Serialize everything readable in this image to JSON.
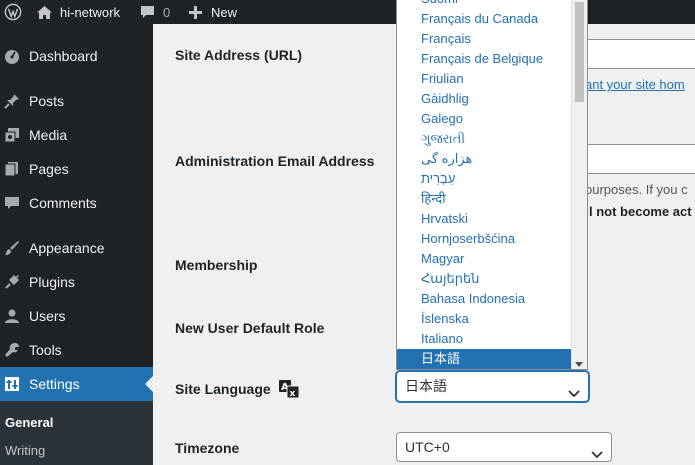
{
  "adminbar": {
    "site_name": "hi-network",
    "comments_count": "0",
    "new_label": "New"
  },
  "sidebar": {
    "items": [
      {
        "label": "Dashboard",
        "icon": "dashboard-icon"
      },
      {
        "label": "Posts",
        "icon": "pin-icon"
      },
      {
        "label": "Media",
        "icon": "media-icon"
      },
      {
        "label": "Pages",
        "icon": "pages-icon"
      },
      {
        "label": "Comments",
        "icon": "comment-icon"
      },
      {
        "label": "Appearance",
        "icon": "brush-icon"
      },
      {
        "label": "Plugins",
        "icon": "plug-icon"
      },
      {
        "label": "Users",
        "icon": "user-icon"
      },
      {
        "label": "Tools",
        "icon": "wrench-icon"
      },
      {
        "label": "Settings",
        "icon": "settings-icon"
      }
    ],
    "submenu": [
      {
        "label": "General"
      },
      {
        "label": "Writing"
      }
    ]
  },
  "form": {
    "site_address_label": "Site Address (URL)",
    "site_address_desc": "ant your site hom",
    "admin_email_label": "Administration Email Address",
    "admin_email_desc1": "ourposes. If you c",
    "admin_email_desc2": "l not become act",
    "membership_label": "Membership",
    "default_role_label": "New User Default Role",
    "site_language_label": "Site Language",
    "site_language_value": "日本語",
    "timezone_label": "Timezone",
    "timezone_value": "UTC+0"
  },
  "language_options": [
    "Suomi",
    "Français du Canada",
    "Français",
    "Français de Belgique",
    "Friulian",
    "Gàidhlig",
    "Galego",
    "ગુજરાતી",
    "هزاره گی",
    "עִבְרִית",
    "हिन्दी",
    "Hrvatski",
    "Hornjoserbšćina",
    "Magyar",
    "Հայերեն",
    "Bahasa Indonesia",
    "Íslenska",
    "Italiano",
    "日本語"
  ],
  "language_selected_index": 18,
  "colors": {
    "accent": "#2271b1",
    "adminbar": "#1d2327",
    "submenu": "#2c3338"
  }
}
